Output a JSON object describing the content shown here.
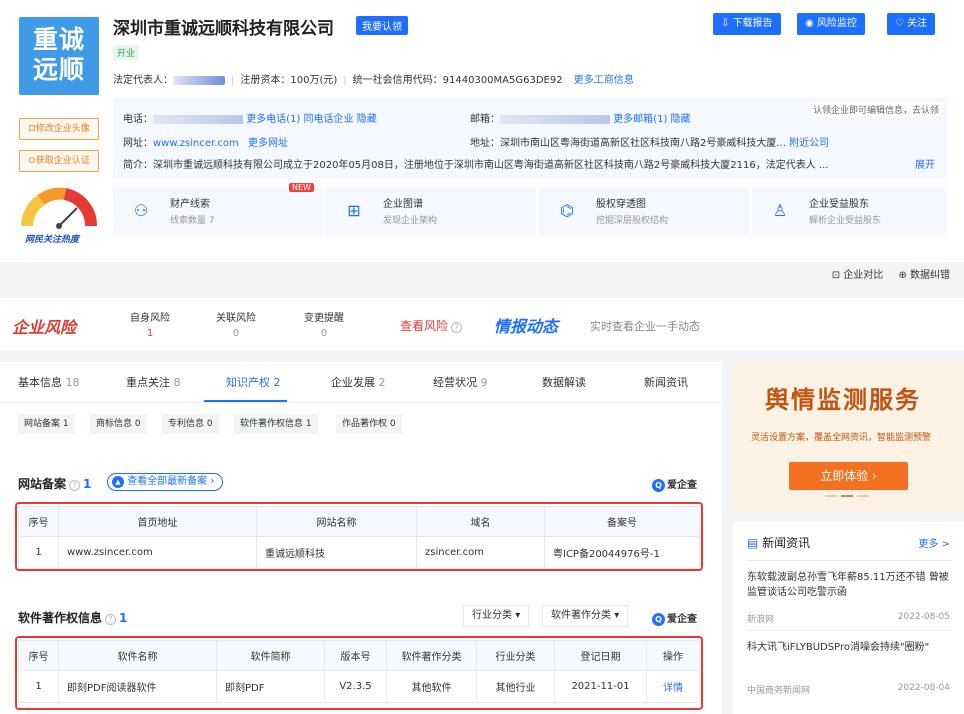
{
  "company": {
    "logo_text": "重诚\n远顺",
    "name": "深圳市重诚远顺科技有限公司",
    "claim_label": "我要认领",
    "status": "开业",
    "legal_rep_label": "法定代表人：",
    "capital": "注册资本：100万(元)",
    "credit_code": "统一社会信用代码：91440300MA5G63DE92",
    "more_business": "更多工商信息"
  },
  "top_buttons": {
    "download": "下载报告",
    "monitor": "风险监控",
    "follow": "关注"
  },
  "side_buttons": {
    "edit_logo": "修改企业头像",
    "get_cert": "获取企业认证",
    "hot_label": "网民关注热度"
  },
  "contact": {
    "phone_label": "电话：",
    "more_phone": "更多电话(1)",
    "same_phone": "同电话企业",
    "hide1": "隐藏",
    "email_label": "邮箱：",
    "more_email": "更多邮箱(1)",
    "hide2": "隐藏",
    "claim_note": "认领企业即可编辑信息，去认领",
    "website_label": "网址：",
    "website": "www.zsincer.com",
    "more_site": "更多网址",
    "address": "地址：深圳市南山区粤海街道高新区社区科技南八路2号豪威科技大厦...",
    "nearby": "附近公司",
    "intro": "简介：深圳市重诚远顺科技有限公司成立于2020年05月08日，注册地位于深圳市南山区粤海街道高新区社区科技南八路2号豪威科技大厦2116，法定代表人 ...",
    "expand": "展开"
  },
  "feature_cards": [
    {
      "title": "财产线索",
      "sub": "线索数量 7",
      "icon": "coins-icon"
    },
    {
      "title": "企业图谱",
      "sub": "发现企业架构",
      "icon": "graph-icon"
    },
    {
      "title": "股权穿透图",
      "sub": "挖掘深层股权结构",
      "icon": "org-tree-icon"
    },
    {
      "title": "企业受益股东",
      "sub": "解析企业受益股东",
      "icon": "shareholder-icon"
    }
  ],
  "new_tag": "NEW",
  "tools": {
    "compare": "企业对比",
    "correct": "数据纠错"
  },
  "risk": {
    "logo": "企业风险",
    "tabs": [
      {
        "label": "自身风险",
        "count": "1"
      },
      {
        "label": "关联风险",
        "count": "0"
      },
      {
        "label": "变更提醒",
        "count": "0"
      }
    ],
    "view_risk": "查看风险",
    "intel": "情报动态",
    "intel_sub": "实时查看企业一手动态"
  },
  "main_tabs": [
    {
      "label": "基本信息",
      "count": "18"
    },
    {
      "label": "重点关注",
      "count": "8"
    },
    {
      "label": "知识产权",
      "count": "2"
    },
    {
      "label": "企业发展",
      "count": "2"
    },
    {
      "label": "经营状况",
      "count": "9"
    },
    {
      "label": "数据解读",
      "count": ""
    },
    {
      "label": "新闻资讯",
      "count": ""
    }
  ],
  "sub_tags": [
    "网站备案 1",
    "商标信息 0",
    "专利信息 0",
    "软件著作权信息 1",
    "作品著作权 0"
  ],
  "website_section": {
    "title": "网站备案",
    "count": "1",
    "see_all": "查看全部最新备案",
    "qcc": "爱企查",
    "headers": [
      "序号",
      "首页地址",
      "网站名称",
      "域名",
      "备案号"
    ],
    "rows": [
      [
        "1",
        "www.zsincer.com",
        "重诚远顺科技",
        "zsincer.com",
        "粤ICP备20044976号-1"
      ]
    ]
  },
  "software_section": {
    "title": "软件著作权信息",
    "count": "1",
    "filter_industry": "行业分类",
    "filter_type": "软件著作分类",
    "qcc": "爱企查",
    "headers": [
      "序号",
      "软件名称",
      "软件简称",
      "版本号",
      "软件著作分类",
      "行业分类",
      "登记日期",
      "操作"
    ],
    "rows": [
      [
        "1",
        "即刻PDF阅读器软件",
        "即刻PDF",
        "V2.3.5",
        "其他软件",
        "其他行业",
        "2021-11-01",
        "详情"
      ]
    ]
  },
  "ad": {
    "title": "舆情监测服务",
    "sub": "灵活设置方案，覆盖全网资讯，智能监测预警",
    "button": "立即体验 ›"
  },
  "news": {
    "title": "新闻资讯",
    "more": "更多 >",
    "items": [
      {
        "title": "东软载波副总孙雪飞年薪85.11万还不错 曾被监管谈话公司吃警示函",
        "source": "新浪网",
        "date": "2022-08-05"
      },
      {
        "title": "科大讯飞iFLYBUDSPro消噪会持续\"圈粉\"",
        "source": "中国商务新闻网",
        "date": "2022-08-04"
      }
    ]
  }
}
